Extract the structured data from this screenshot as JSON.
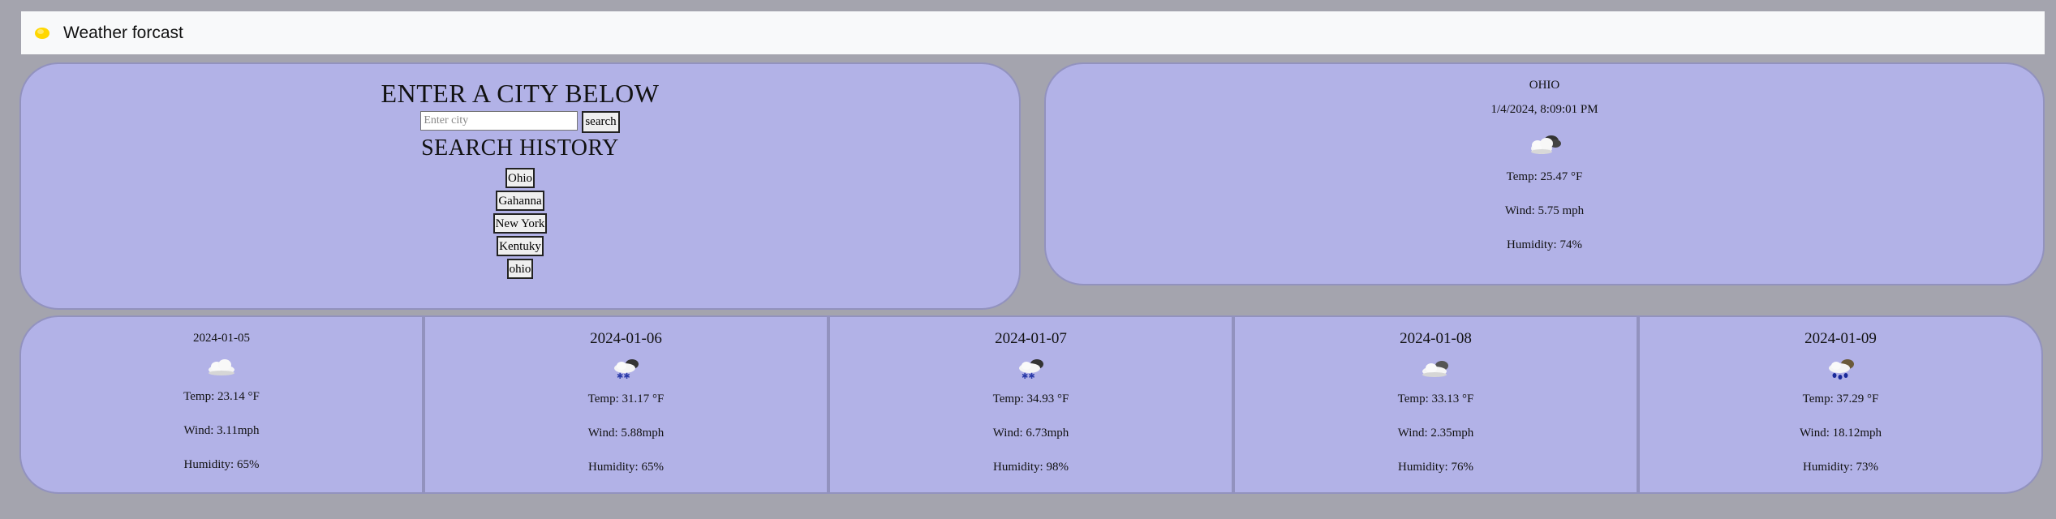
{
  "app": {
    "brand_title": "Weather forcast"
  },
  "search": {
    "heading": "ENTER A CITY BELOW",
    "input_placeholder": "Enter city",
    "input_value": "",
    "button_label": "search",
    "history_heading": "SEARCH HISTORY",
    "history": [
      "Ohio",
      "Gahanna",
      "New York",
      "Kentuky",
      "ohio"
    ]
  },
  "current": {
    "city": "OHIO",
    "datetime": "1/4/2024, 8:09:01 PM",
    "icon": "cloudy-night-icon",
    "temp": "Temp: 25.47 °F",
    "wind": "Wind: 5.75 mph",
    "humidity": "Humidity: 74%"
  },
  "forecast": [
    {
      "date": "2024-01-05",
      "icon": "cloud-icon",
      "temp": "Temp: 23.14 °F",
      "wind": "Wind: 3.11mph",
      "humidity": "Humidity: 65%"
    },
    {
      "date": "2024-01-06",
      "icon": "snow-cloud-icon",
      "temp": "Temp: 31.17 °F",
      "wind": "Wind: 5.88mph",
      "humidity": "Humidity: 65%"
    },
    {
      "date": "2024-01-07",
      "icon": "snow-cloud-icon",
      "temp": "Temp: 34.93 °F",
      "wind": "Wind: 6.73mph",
      "humidity": "Humidity: 98%"
    },
    {
      "date": "2024-01-08",
      "icon": "cloud-icon",
      "temp": "Temp: 33.13 °F",
      "wind": "Wind: 2.35mph",
      "humidity": "Humidity: 76%"
    },
    {
      "date": "2024-01-09",
      "icon": "rain-cloud-icon",
      "temp": "Temp: 37.29 °F",
      "wind": "Wind: 18.12mph",
      "humidity": "Humidity: 73%"
    }
  ],
  "colors": {
    "page_bg": "#a4a4ae",
    "card_bg": "#b2b2e7",
    "navbar_bg": "#f8f9fa",
    "logo_yellow": "#ffd700"
  }
}
